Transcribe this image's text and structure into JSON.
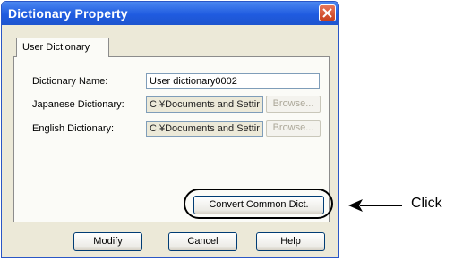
{
  "window": {
    "title": "Dictionary Property"
  },
  "tabs": [
    {
      "label": "User Dictionary"
    }
  ],
  "fields": {
    "dictionary_name": {
      "label": "Dictionary Name:",
      "value": "User dictionary0002"
    },
    "japanese_dictionary": {
      "label": "Japanese Dictionary:",
      "value": "C:¥Documents and Settir",
      "browse_label": "Browse..."
    },
    "english_dictionary": {
      "label": "English Dictionary:",
      "value": "C:¥Documents and Settir",
      "browse_label": "Browse..."
    }
  },
  "buttons": {
    "convert": "Convert Common Dict.",
    "modify": "Modify",
    "cancel": "Cancel",
    "help": "Help"
  },
  "annotation": {
    "text": "Click"
  },
  "icons": {
    "close": "close-icon",
    "arrow": "arrow-left-icon"
  },
  "colors": {
    "title_bar": "#1f5be0",
    "close_button": "#c8411f",
    "window_bg": "#ece9d8"
  }
}
